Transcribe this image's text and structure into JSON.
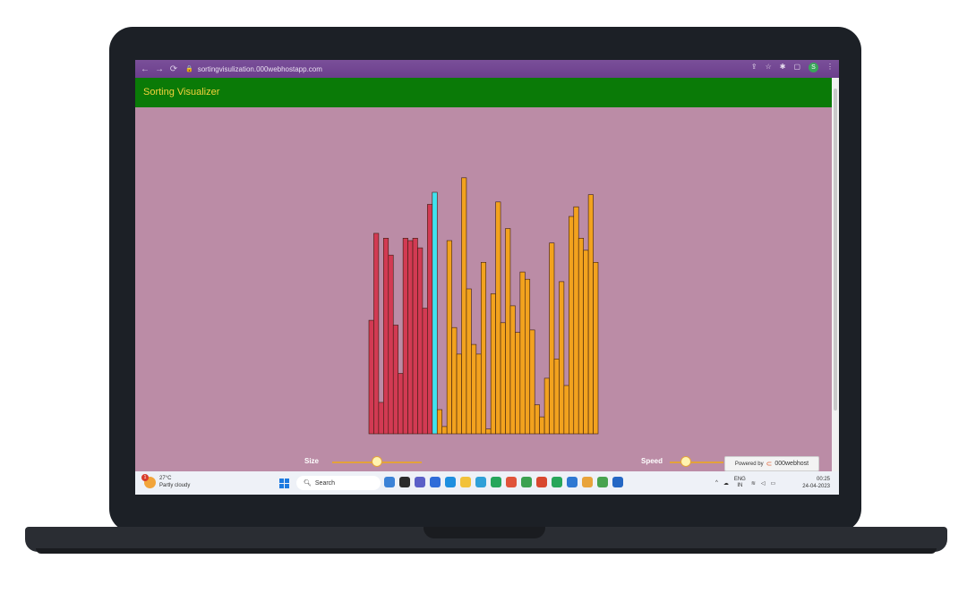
{
  "browser": {
    "url": "sortingvisulization.000webhostapp.com",
    "back_icon": "arrow-left-icon",
    "forward_icon": "arrow-right-icon",
    "reload_icon": "reload-icon",
    "profile_initial": "S"
  },
  "app": {
    "title": "Sorting Visualizer",
    "header_color": "#0a7a07",
    "title_color": "#f4d23c",
    "background": "#bb8ca6"
  },
  "visualizer": {
    "colors": {
      "sorted": "#d23a53",
      "active": "#3fe3ef",
      "unsorted": "#f2a21e"
    },
    "bars": [
      {
        "v": 0.47,
        "s": "sorted"
      },
      {
        "v": 0.83,
        "s": "sorted"
      },
      {
        "v": 0.13,
        "s": "sorted"
      },
      {
        "v": 0.81,
        "s": "sorted"
      },
      {
        "v": 0.74,
        "s": "sorted"
      },
      {
        "v": 0.45,
        "s": "sorted"
      },
      {
        "v": 0.25,
        "s": "sorted"
      },
      {
        "v": 0.81,
        "s": "sorted"
      },
      {
        "v": 0.8,
        "s": "sorted"
      },
      {
        "v": 0.81,
        "s": "sorted"
      },
      {
        "v": 0.77,
        "s": "sorted"
      },
      {
        "v": 0.52,
        "s": "sorted"
      },
      {
        "v": 0.95,
        "s": "sorted"
      },
      {
        "v": 1.0,
        "s": "active"
      },
      {
        "v": 0.1,
        "s": "unsorted"
      },
      {
        "v": 0.03,
        "s": "unsorted"
      },
      {
        "v": 0.8,
        "s": "unsorted"
      },
      {
        "v": 0.44,
        "s": "unsorted"
      },
      {
        "v": 0.33,
        "s": "unsorted"
      },
      {
        "v": 1.06,
        "s": "unsorted"
      },
      {
        "v": 0.6,
        "s": "unsorted"
      },
      {
        "v": 0.37,
        "s": "unsorted"
      },
      {
        "v": 0.33,
        "s": "unsorted"
      },
      {
        "v": 0.71,
        "s": "unsorted"
      },
      {
        "v": 0.02,
        "s": "unsorted"
      },
      {
        "v": 0.58,
        "s": "unsorted"
      },
      {
        "v": 0.96,
        "s": "unsorted"
      },
      {
        "v": 0.46,
        "s": "unsorted"
      },
      {
        "v": 0.85,
        "s": "unsorted"
      },
      {
        "v": 0.53,
        "s": "unsorted"
      },
      {
        "v": 0.42,
        "s": "unsorted"
      },
      {
        "v": 0.67,
        "s": "unsorted"
      },
      {
        "v": 0.64,
        "s": "unsorted"
      },
      {
        "v": 0.43,
        "s": "unsorted"
      },
      {
        "v": 0.12,
        "s": "unsorted"
      },
      {
        "v": 0.07,
        "s": "unsorted"
      },
      {
        "v": 0.23,
        "s": "unsorted"
      },
      {
        "v": 0.79,
        "s": "unsorted"
      },
      {
        "v": 0.31,
        "s": "unsorted"
      },
      {
        "v": 0.63,
        "s": "unsorted"
      },
      {
        "v": 0.2,
        "s": "unsorted"
      },
      {
        "v": 0.9,
        "s": "unsorted"
      },
      {
        "v": 0.94,
        "s": "unsorted"
      },
      {
        "v": 0.81,
        "s": "unsorted"
      },
      {
        "v": 0.76,
        "s": "unsorted"
      },
      {
        "v": 0.99,
        "s": "unsorted"
      },
      {
        "v": 0.71,
        "s": "unsorted"
      }
    ]
  },
  "controls": {
    "size_label": "Size",
    "size_value": 0.5,
    "speed_label": "Speed",
    "speed_value": 0.3
  },
  "hosting": {
    "prefix": "Powered by",
    "brand": "000webhost"
  },
  "taskbar": {
    "weather_temp": "27°C",
    "weather_desc": "Partly cloudy",
    "weather_badge": "1",
    "search_label": "Search",
    "lang_top": "ENG",
    "lang_bottom": "IN",
    "time": "00:25",
    "date": "24-04-2023"
  }
}
